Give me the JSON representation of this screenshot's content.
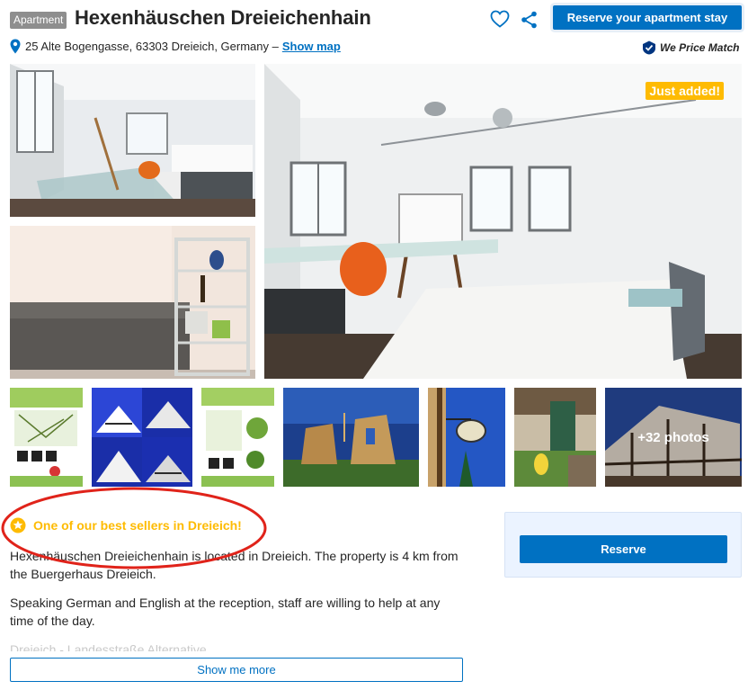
{
  "header": {
    "type_badge": "Apartment",
    "title": "Hexenhäuschen Dreieichenhain",
    "reserve_button": "Reserve your apartment stay",
    "heart_icon": "heart-icon",
    "share_icon": "share-icon"
  },
  "address": {
    "text": "25 Alte Bogengasse, 63303 Dreieich, Germany –",
    "show_map": "Show map",
    "pin_icon": "map-pin-icon"
  },
  "price_match": {
    "label": "We Price Match",
    "icon": "thumbs-up-badge-icon"
  },
  "photos": {
    "badge": "Just added!",
    "more_label": "+32 photos"
  },
  "description": {
    "best_seller": "One of our best sellers in Dreieich!",
    "para1": "Hexenhäuschen Dreieichenhain is located in Dreieich. The property is 4 km from the Buergerhaus Dreieich.",
    "para2": "Speaking German and English at the reception, staff are willing to help at any time of the day.",
    "para3": "Dreieich - Landesstraße Alternative...",
    "show_more": "Show me more"
  },
  "side": {
    "reserve_button": "Reserve"
  },
  "colors": {
    "brand_blue": "#0071c2",
    "gold": "#febb02",
    "annotation_red": "#e0231a",
    "panel_bg": "#ebf3ff"
  }
}
